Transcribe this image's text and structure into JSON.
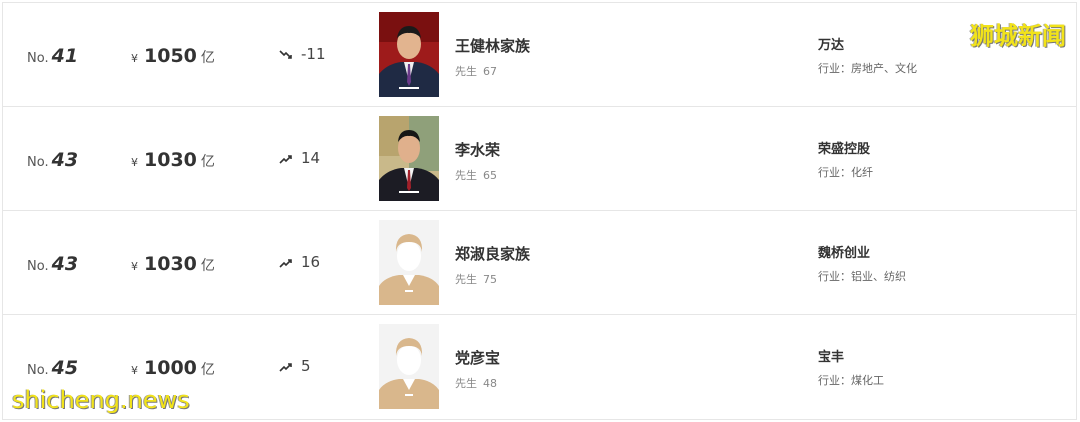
{
  "rows": [
    {
      "rank_prefix": "No.",
      "rank": "41",
      "currency": "¥",
      "wealth": "1050",
      "unit": "亿",
      "trend": "down",
      "change": "-11",
      "photo": "portrait-photo",
      "name": "王健林家族",
      "title": "先生",
      "age": "67",
      "company": "万达",
      "industry": "行业：房地产、文化"
    },
    {
      "rank_prefix": "No.",
      "rank": "43",
      "currency": "¥",
      "wealth": "1030",
      "unit": "亿",
      "trend": "up",
      "change": "14",
      "photo": "portrait-photo",
      "name": "李水荣",
      "title": "先生",
      "age": "65",
      "company": "荣盛控股",
      "industry": "行业：化纤"
    },
    {
      "rank_prefix": "No.",
      "rank": "43",
      "currency": "¥",
      "wealth": "1030",
      "unit": "亿",
      "trend": "up",
      "change": "16",
      "photo": "avatar-placeholder",
      "name": "郑淑良家族",
      "title": "先生",
      "age": "75",
      "company": "魏桥创业",
      "industry": "行业：铝业、纺织"
    },
    {
      "rank_prefix": "No.",
      "rank": "45",
      "currency": "¥",
      "wealth": "1000",
      "unit": "亿",
      "trend": "up",
      "change": "5",
      "photo": "avatar-placeholder",
      "name": "党彦宝",
      "title": "先生",
      "age": "48",
      "company": "宝丰",
      "industry": "行业：煤化工"
    }
  ],
  "watermarks": {
    "top": "狮城新闻",
    "bottom": "shicheng.news"
  },
  "colors": {
    "watermark": "#f2e31a",
    "avatar_bg": "#d9b78c",
    "photo1_bg": "#9e1b1b",
    "divider": "#e6e6e6"
  }
}
